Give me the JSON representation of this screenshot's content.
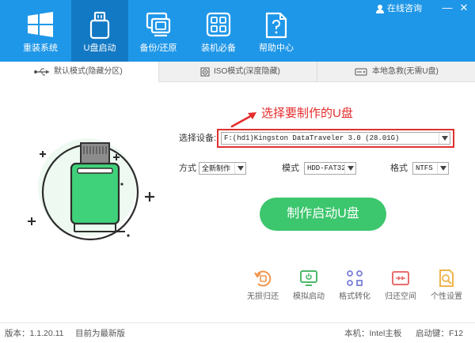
{
  "window": {
    "service_label": "在线咨询",
    "minimize_symbol": "—",
    "close_symbol": "✕"
  },
  "nav": {
    "items": [
      {
        "label": "重装系统",
        "icon": "windows-icon"
      },
      {
        "label": "U盘启动",
        "icon": "usb-drive-icon",
        "active": true
      },
      {
        "label": "备份/还原",
        "icon": "backup-icon"
      },
      {
        "label": "装机必备",
        "icon": "apps-icon"
      },
      {
        "label": "帮助中心",
        "icon": "help-icon"
      }
    ]
  },
  "tabs": [
    {
      "label": "默认模式(隐藏分区)",
      "icon": "usb-symbol-icon",
      "active": true
    },
    {
      "label": "ISO模式(深度隐藏)",
      "icon": "disc-icon"
    },
    {
      "label": "本地急救(无需U盘)",
      "icon": "drive-icon"
    }
  ],
  "form": {
    "annotation": "选择要制作的U盘",
    "device_label": "选择设备:",
    "device_value": "F:(hd1)Kingston DataTraveler 3.0 (28.01G)",
    "method_label": "方式",
    "method_value": "全新制作",
    "mode_label": "模式",
    "mode_value": "HDD-FAT32",
    "format_label": "格式",
    "format_value": "NTFS",
    "create_button": "制作启动U盘"
  },
  "tools": [
    {
      "label": "无损归还",
      "icon": "restore-icon"
    },
    {
      "label": "模拟启动",
      "icon": "simulate-boot-icon"
    },
    {
      "label": "格式转化",
      "icon": "format-convert-icon"
    },
    {
      "label": "归还空间",
      "icon": "reclaim-space-icon"
    },
    {
      "label": "个性设置",
      "icon": "personalize-icon"
    }
  ],
  "status": {
    "version": "版本：1.1.20.11",
    "latest": "目前为最新版",
    "machine": "本机：Intel主板",
    "hotkey": "启动键：F12"
  },
  "colors": {
    "header_blue": "#1f97e8",
    "active_nav": "#1279c4",
    "accent_green": "#3cc66d",
    "alert_red": "#e52b2b"
  }
}
